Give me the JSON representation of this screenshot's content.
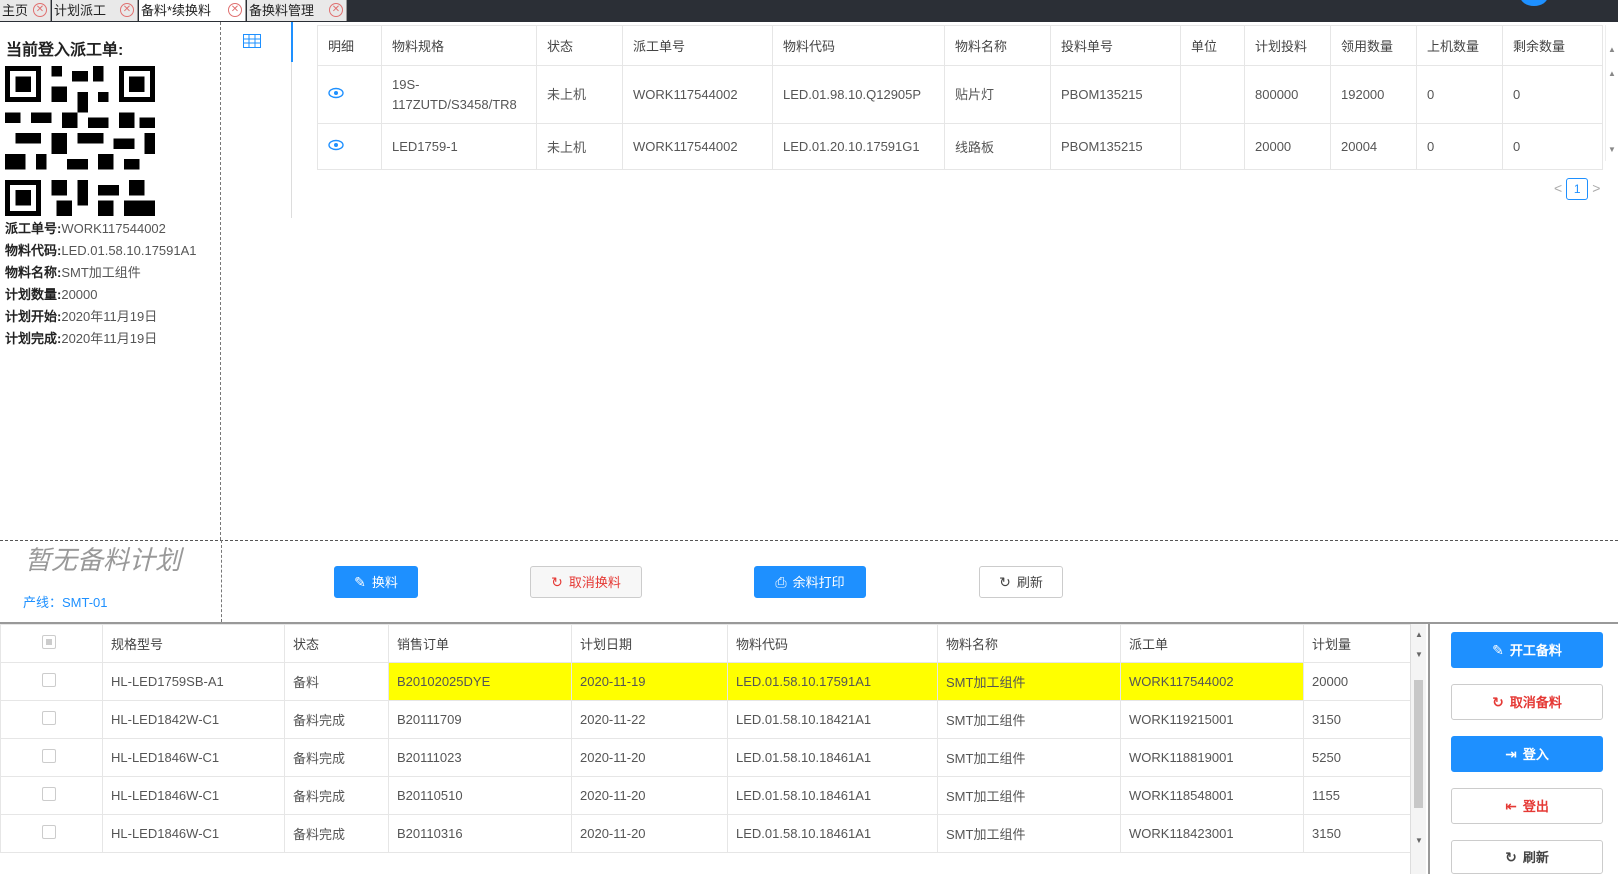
{
  "tabs": [
    {
      "label": "主页"
    },
    {
      "label": "计划派工"
    },
    {
      "label": "备料*续换料"
    },
    {
      "label": "备换料管理"
    }
  ],
  "left": {
    "title": "当前登入派工单:",
    "fields": [
      {
        "label": "派工单号:",
        "value": "WORK117544002"
      },
      {
        "label": "物料代码:",
        "value": "LED.01.58.10.17591A1"
      },
      {
        "label": "物料名称:",
        "value": "SMT加工组件"
      },
      {
        "label": "计划数量:",
        "value": "20000"
      },
      {
        "label": "计划开始:",
        "value": "2020年11月19日"
      },
      {
        "label": "计划完成:",
        "value": "2020年11月19日"
      }
    ],
    "no_plan": "暂无备料计划",
    "line": "产线：SMT-01"
  },
  "upper_table": {
    "headers": [
      "明细",
      "物料规格",
      "状态",
      "派工单号",
      "物料代码",
      "物料名称",
      "投料单号",
      "单位",
      "计划投料",
      "领用数量",
      "上机数量",
      "剩余数量"
    ],
    "rows": [
      [
        "",
        "19S-117ZUTD/S3458/TR8",
        "未上机",
        "WORK117544002",
        "LED.01.98.10.Q12905P",
        "贴片灯",
        "PBOM135215",
        "",
        "800000",
        "192000",
        "0",
        "0"
      ],
      [
        "",
        "LED1759-1",
        "未上机",
        "WORK117544002",
        "LED.01.20.10.17591G1",
        "线路板",
        "PBOM135215",
        "",
        "20000",
        "20004",
        "0",
        "0"
      ]
    ],
    "page": "1"
  },
  "actions": {
    "change": "换料",
    "cancel_change": "取消换料",
    "print_remain": "余料打印",
    "refresh": "刷新"
  },
  "lower_table": {
    "headers": [
      "",
      "规格型号",
      "状态",
      "销售订单",
      "计划日期",
      "物料代码",
      "物料名称",
      "派工单",
      "计划量"
    ],
    "rows": [
      [
        "",
        "HL-LED1759SB-A1",
        "备料",
        "B20102025DYE",
        "2020-11-19",
        "LED.01.58.10.17591A1",
        "SMT加工组件",
        "WORK117544002",
        "20000"
      ],
      [
        "",
        "HL-LED1842W-C1",
        "备料完成",
        "B20111709",
        "2020-11-22",
        "LED.01.58.10.18421A1",
        "SMT加工组件",
        "WORK119215001",
        "3150"
      ],
      [
        "",
        "HL-LED1846W-C1",
        "备料完成",
        "B20111023",
        "2020-11-20",
        "LED.01.58.10.18461A1",
        "SMT加工组件",
        "WORK118819001",
        "5250"
      ],
      [
        "",
        "HL-LED1846W-C1",
        "备料完成",
        "B20110510",
        "2020-11-20",
        "LED.01.58.10.18461A1",
        "SMT加工组件",
        "WORK118548001",
        "1155"
      ],
      [
        "",
        "HL-LED1846W-C1",
        "备料完成",
        "B20110316",
        "2020-11-20",
        "LED.01.58.10.18461A1",
        "SMT加工组件",
        "WORK118423001",
        "3150"
      ]
    ]
  },
  "side_buttons": {
    "start": "开工备料",
    "cancel": "取消备料",
    "login": "登入",
    "logout": "登出",
    "refresh": "刷新"
  },
  "colors": {
    "accent": "#1e90ff",
    "danger": "#e53935",
    "highlight": "#ffff00"
  }
}
